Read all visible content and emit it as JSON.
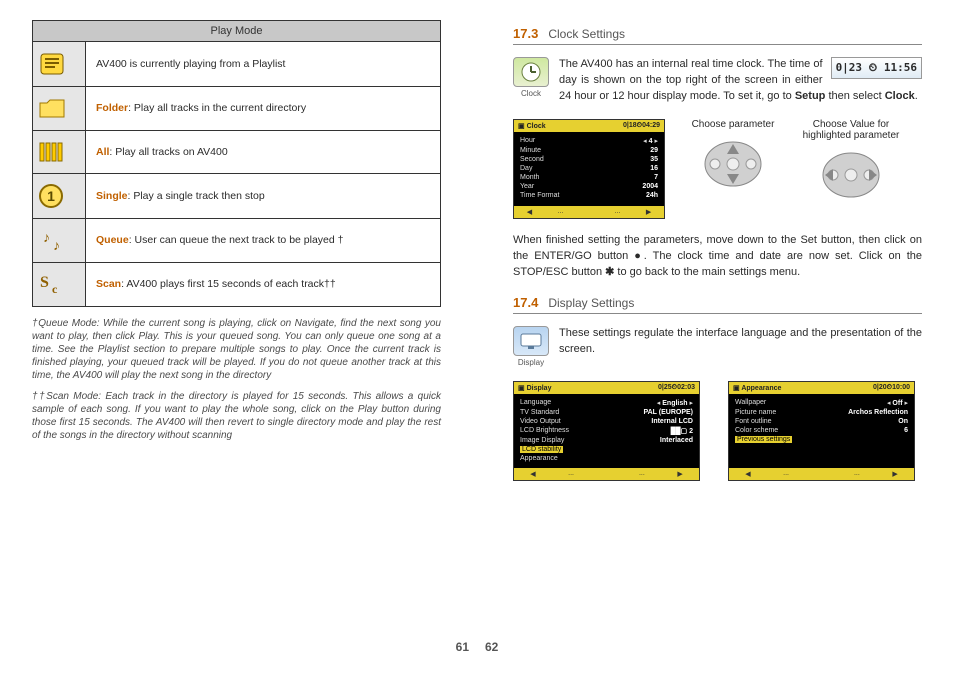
{
  "left": {
    "tableHeader": "Play Mode",
    "rows": [
      {
        "text": "AV400 is currently playing from a Playlist"
      },
      {
        "label": "Folder",
        "text": ": Play all tracks in the current directory"
      },
      {
        "label": "All",
        "text": ": Play all tracks on AV400"
      },
      {
        "label": "Single",
        "text": ": Play a single track then stop"
      },
      {
        "label": "Queue",
        "text": ": User can queue the next track to be played †"
      },
      {
        "label": "Scan",
        "text": ": AV400 plays first 15 seconds of each track††"
      }
    ],
    "fn1": "†Queue Mode: While the current song is playing, click on Navigate, find the next song you want to play, then click Play. This is your queued song. You can only queue one song at a time. See the Playlist section to prepare multiple songs to play. Once the current track is finished playing, your queued track will be played. If you do not queue another track at this time, the AV400 will play the next song in the directory",
    "fn2": "††Scan Mode: Each track in the directory is played for 15 seconds. This allows a quick sample of each song. If you want to play the whole song, click on the Play button during those first 15 seconds. The AV400 will then revert to single directory mode and play the rest of the songs in the directory without scanning"
  },
  "right": {
    "s173num": "17.3",
    "s173title": "Clock Settings",
    "clockIconLabel": "Clock",
    "clockStrip": "0|23 ⏲ 11:56",
    "para1a": "The AV400 has an internal real time clock. The time of day is shown on the top right of the screen in either 24 hour or 12 hour display mode. To set it, go to ",
    "para1b": "Setup",
    "para1c": " then select ",
    "para1d": "Clock",
    "para1e": ".",
    "chooseParam": "Choose parameter",
    "chooseValue": "Choose Value for highlighted parameter",
    "clockLcd": {
      "title": "Clock",
      "status": "0|18⏲04:29",
      "rows": [
        [
          "Hour",
          "◂",
          "4",
          "▸"
        ],
        [
          "Minute",
          "",
          "29",
          ""
        ],
        [
          "Second",
          "",
          "35",
          ""
        ],
        [
          "Day",
          "",
          "16",
          ""
        ],
        [
          "Month",
          "",
          "7",
          ""
        ],
        [
          "Year",
          "",
          "2004",
          ""
        ],
        [
          "Time Format",
          "",
          "24h",
          ""
        ]
      ],
      "bot": [
        "◀",
        "...",
        "",
        "...",
        "▶"
      ]
    },
    "para2a": "When finished setting the parameters, move down to the Set button, then click on the ENTER/GO button ",
    "para2b": ". The clock time and date are now set. Click on the STOP/ESC button ",
    "para2c": " to go back to the main settings menu.",
    "s174num": "17.4",
    "s174title": "Display Settings",
    "displayIconLabel": "Display",
    "para3": "These settings regulate the interface language and the presentation of the screen.",
    "dispLcd": {
      "title": "Display",
      "status": "0|25⏲02:03",
      "rows": [
        [
          "Language",
          "◂",
          "English",
          "▸"
        ],
        [
          "TV Standard",
          "",
          "PAL (EUROPE)",
          ""
        ],
        [
          "Video Output",
          "",
          "Internal LCD",
          ""
        ],
        [
          "LCD Brightness",
          "",
          "██▢ 2",
          ""
        ],
        [
          "Image Display",
          "",
          "Interlaced",
          ""
        ],
        [
          "LCD stability",
          "",
          "",
          ""
        ],
        [
          "Appearance",
          "",
          "",
          ""
        ]
      ],
      "hi": 5,
      "bot": [
        "◀",
        "...",
        "",
        "...",
        "▶"
      ]
    },
    "appLcd": {
      "title": "Appearance",
      "status": "0|20⏲10:00",
      "rows": [
        [
          "Wallpaper",
          "◂",
          "Off",
          "▸"
        ],
        [
          "Picture name",
          "",
          "Archos Reflection",
          ""
        ],
        [
          "Font outline",
          "",
          "On",
          ""
        ],
        [
          "Color scheme",
          "",
          "6",
          ""
        ],
        [
          "Previous settings",
          "",
          "",
          ""
        ]
      ],
      "hi": 4,
      "bot": [
        "◀",
        "...",
        "",
        "...",
        "▶"
      ]
    }
  },
  "folio": {
    "l": "61",
    "r": "62"
  }
}
